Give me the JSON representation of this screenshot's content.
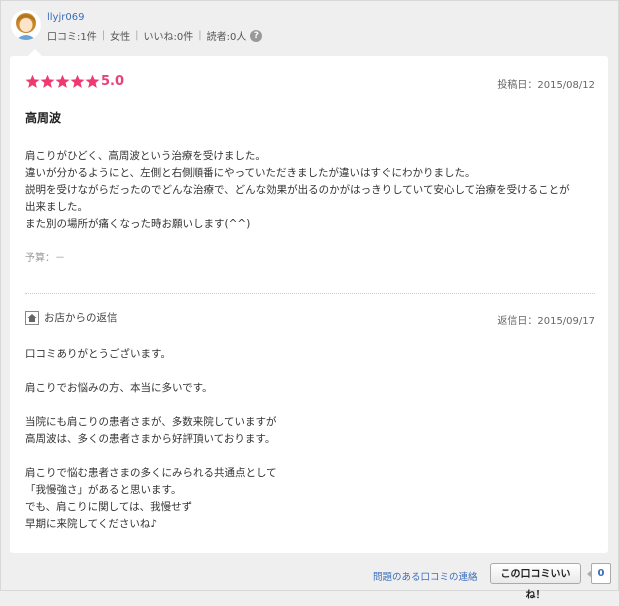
{
  "reviewer": {
    "username": "llyjr069",
    "stats": [
      "口コミ:1件",
      "女性",
      "いいね:0件",
      "読者:0人"
    ],
    "help_icon": "?"
  },
  "review": {
    "stars": 5,
    "rating": "5.0",
    "post_date": "投稿日：2015/08/12",
    "title": "高周波",
    "body": [
      "肩こりがひどく、高周波という治療を受けました。",
      "違いが分かるようにと、左側と右側順番にやっていただきましたが違いはすぐにわかりました。",
      "説明を受けながらだったのでどんな治療で、どんな効果が出るのかがはっきりしていて安心して治療を受けることが",
      "出来ました。",
      "また別の場所が痛くなった時お願いします(^^)"
    ],
    "budget": "予算：－"
  },
  "reply": {
    "heading": "お店からの返信",
    "date": "返信日：2015/09/17",
    "body": [
      "口コミありがとうございます。",
      "",
      "肩こりでお悩みの方、本当に多いです。",
      "",
      "当院にも肩こりの患者さまが、多数来院していますが",
      "高周波は、多くの患者さまから好評頂いております。",
      "",
      "肩こりで悩む患者さまの多くにみられる共通点として",
      "「我慢強さ」があると思います。",
      "でも、肩こりに関しては、我慢せず",
      "早期に来院してくださいね♪"
    ]
  },
  "footer": {
    "report_link": "問題のある口コミの連絡",
    "like_button": "この口コミいいね！",
    "like_count": "0"
  },
  "colors": {
    "star": "#ef3a6f",
    "link": "#3b6dbb",
    "rating": "#e8407b"
  }
}
